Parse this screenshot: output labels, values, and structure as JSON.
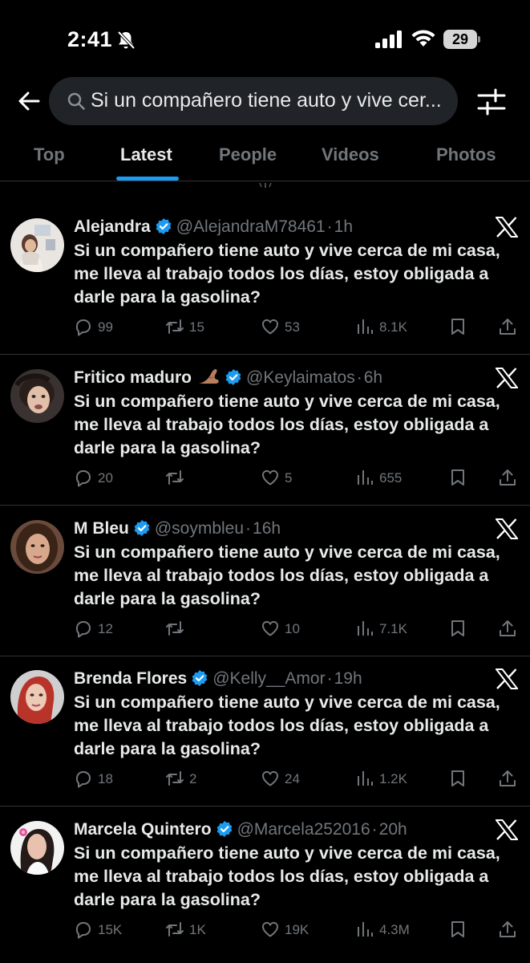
{
  "status_bar": {
    "time": "2:41",
    "battery": "29"
  },
  "search": {
    "query": "Si un compañero tiene auto y vive cer..."
  },
  "tabs": [
    {
      "label": "Top"
    },
    {
      "label": "Latest"
    },
    {
      "label": "People"
    },
    {
      "label": "Videos"
    },
    {
      "label": "Photos"
    }
  ],
  "accent_color": "#1d9bf0",
  "tweets": [
    {
      "name": "Alejandra",
      "handle": "@AlejandraM78461",
      "age": "1h",
      "text": "Si un compañero tiene auto y vive cerca de mi casa, me lleva al trabajo todos los días, estoy obligada a darle para la gasolina?",
      "replies": "99",
      "reposts": "15",
      "likes": "53",
      "views": "8.1K"
    },
    {
      "name": "Fritico maduro",
      "handle": "@Keylaimatos",
      "age": "6h",
      "emoji": "pinching-hand-emoji",
      "text": "Si un compañero tiene auto y vive cerca de mi casa, me lleva al trabajo todos los días, estoy obligada a darle para la gasolina?",
      "replies": "20",
      "reposts": "",
      "likes": "5",
      "views": "655"
    },
    {
      "name": "M Bleu",
      "handle": "@soymbleu",
      "age": "16h",
      "text": "Si un compañero tiene auto y vive cerca de mi casa, me lleva al trabajo todos los días, estoy obligada a darle para la gasolina?",
      "replies": "12",
      "reposts": "",
      "likes": "10",
      "views": "7.1K"
    },
    {
      "name": "Brenda Flores",
      "handle": "@Kelly__Amor",
      "age": "19h",
      "text": "Si un compañero tiene auto y vive cerca de mi casa, me lleva al trabajo todos los días, estoy obligada a darle para la gasolina?",
      "replies": "18",
      "reposts": "2",
      "likes": "24",
      "views": "1.2K"
    },
    {
      "name": "Marcela Quintero",
      "handle": "@Marcela252016",
      "age": "20h",
      "text": "Si un compañero tiene auto y vive cerca de mi casa, me lleva al trabajo todos los días, estoy obligada a darle para la gasolina?",
      "replies": "15K",
      "reposts": "1K",
      "likes": "19K",
      "views": "4.3M"
    }
  ]
}
